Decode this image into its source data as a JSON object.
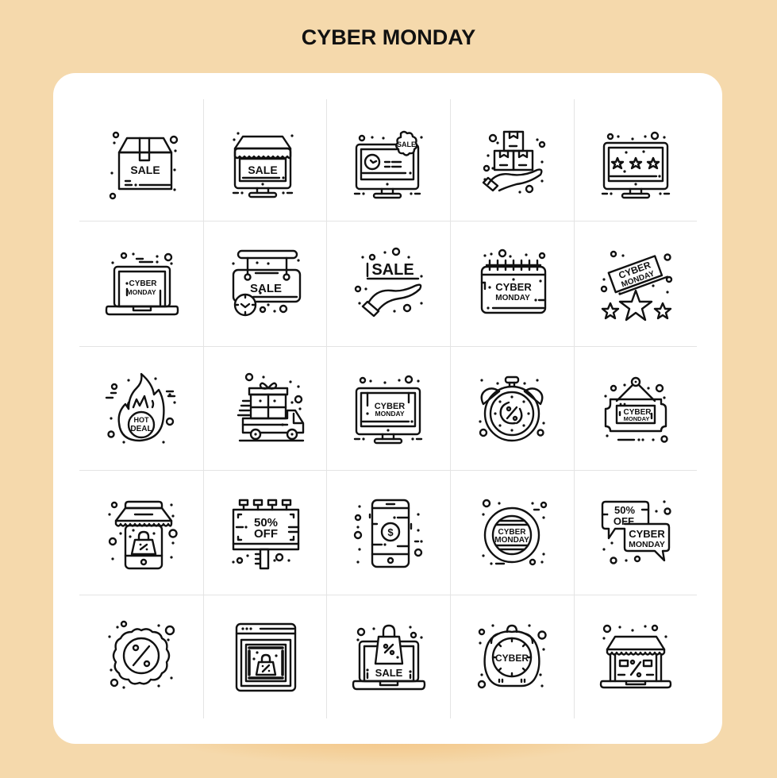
{
  "page": {
    "title": "CYBER MONDAY",
    "colors": {
      "background": "#F5D9AC",
      "card": "#FFFFFF",
      "icon_stroke": "#111111",
      "grid_line": "#E4E4E4",
      "glow": "#E88C1E"
    }
  },
  "icons": [
    {
      "name": "sale-box-icon",
      "text": "SALE"
    },
    {
      "name": "online-store-sale-icon",
      "text": "SALE"
    },
    {
      "name": "monitor-sale-badge-icon",
      "text": "SALE"
    },
    {
      "name": "hand-holding-boxes-icon"
    },
    {
      "name": "monitor-rating-stars-icon"
    },
    {
      "name": "laptop-cyber-monday-icon",
      "text1": "CYBER",
      "text2": "MONDAY"
    },
    {
      "name": "hanging-sale-sign-clock-icon",
      "text": "SALE"
    },
    {
      "name": "hand-sale-icon",
      "text": "SALE"
    },
    {
      "name": "calendar-cyber-monday-icon",
      "text1": "CYBER",
      "text2": "MONDAY"
    },
    {
      "name": "cyber-monday-stars-banner-icon",
      "text1": "CYBER",
      "text2": "MONDAY"
    },
    {
      "name": "hot-deal-fire-icon",
      "text1": "HOT",
      "text2": "DEAL"
    },
    {
      "name": "gift-delivery-truck-icon"
    },
    {
      "name": "monitor-cyber-monday-icon",
      "text1": "CYBER",
      "text2": "MONDAY"
    },
    {
      "name": "discount-alarm-clock-icon"
    },
    {
      "name": "hanging-cyber-monday-sign-icon",
      "text1": "CYBER",
      "text2": "MONDAY"
    },
    {
      "name": "mobile-shop-bag-icon"
    },
    {
      "name": "billboard-50-off-icon",
      "text1": "50%",
      "text2": "OFF"
    },
    {
      "name": "mobile-dollar-icon",
      "text": "$"
    },
    {
      "name": "cyber-monday-circle-badge-icon",
      "text1": "CYBER",
      "text2": "MONDAY"
    },
    {
      "name": "chat-bubbles-offer-icon",
      "text1": "50%",
      "text2": "OFF.",
      "text3": "CYBER",
      "text4": "MONDAY"
    },
    {
      "name": "percent-badge-icon"
    },
    {
      "name": "browser-shopping-bag-icon"
    },
    {
      "name": "laptop-shopping-bag-sale-icon",
      "text": "SALE"
    },
    {
      "name": "cyber-clock-icon",
      "text": "CYBER"
    },
    {
      "name": "laptop-store-discount-icon"
    }
  ]
}
